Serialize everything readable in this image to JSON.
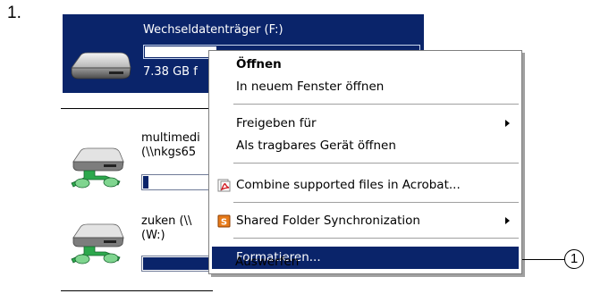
{
  "step_number": "1.",
  "selected_drive": {
    "name": "Wechseldatenträger (F:)",
    "size_text": "7.38 GB f",
    "used_fraction": 0.26,
    "icon": "removable-drive-icon"
  },
  "network_drives": [
    {
      "name_line1": "multimedi",
      "name_line2": "(\\\\nkgs65",
      "used_fraction": 0.08,
      "icon": "network-drive-icon"
    },
    {
      "name_line1": "zuken (\\\\",
      "name_line2": "(W:)",
      "used_fraction": 0.95,
      "icon": "network-drive-icon"
    }
  ],
  "context_menu": {
    "items": [
      {
        "label": "Öffnen",
        "bold": true
      },
      {
        "label": "In neuem Fenster öffnen"
      },
      {
        "label": "Freigeben für",
        "submenu": true
      },
      {
        "label": "Als tragbares Gerät öffnen"
      },
      {
        "label": "Combine supported files in Acrobat...",
        "icon": "acrobat-icon"
      },
      {
        "label": "Shared Folder Synchronization",
        "icon": "sync-icon",
        "submenu": true
      },
      {
        "label": "Formatieren...",
        "highlighted": true
      },
      {
        "label": "Auswerfen"
      }
    ]
  },
  "callout": {
    "number": "1"
  },
  "colors": {
    "selection": "#0a246a",
    "menu_border": "#7f7f7f",
    "separator": "#a0a0a0"
  }
}
